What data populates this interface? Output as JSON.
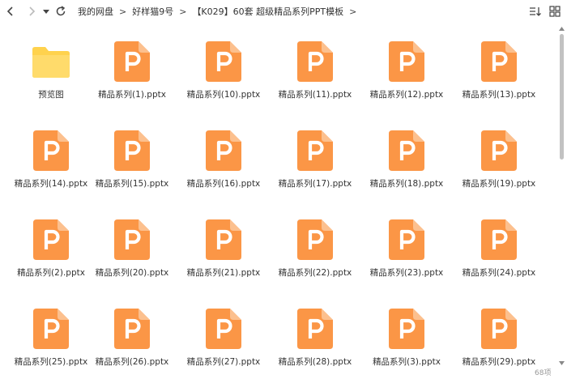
{
  "toolbar": {
    "breadcrumb": [
      "我的网盘",
      "好样猫9号",
      "【K029】60套 超级精品系列PPT模板"
    ],
    "separator": ">"
  },
  "colors": {
    "folder": "#ffd24d",
    "ppt_icon": "#fb9646",
    "ppt_icon_fold": "#fcc08e"
  },
  "items": [
    {
      "name": "预览图",
      "type": "folder"
    },
    {
      "name": "精品系列(1).pptx",
      "type": "pptx"
    },
    {
      "name": "精品系列(10).pptx",
      "type": "pptx"
    },
    {
      "name": "精品系列(11).pptx",
      "type": "pptx"
    },
    {
      "name": "精品系列(12).pptx",
      "type": "pptx"
    },
    {
      "name": "精品系列(13).pptx",
      "type": "pptx"
    },
    {
      "name": "精品系列(14).pptx",
      "type": "pptx"
    },
    {
      "name": "精品系列(15).pptx",
      "type": "pptx"
    },
    {
      "name": "精品系列(16).pptx",
      "type": "pptx"
    },
    {
      "name": "精品系列(17).pptx",
      "type": "pptx"
    },
    {
      "name": "精品系列(18).pptx",
      "type": "pptx"
    },
    {
      "name": "精品系列(19).pptx",
      "type": "pptx"
    },
    {
      "name": "精品系列(2).pptx",
      "type": "pptx"
    },
    {
      "name": "精品系列(20).pptx",
      "type": "pptx"
    },
    {
      "name": "精品系列(21).pptx",
      "type": "pptx"
    },
    {
      "name": "精品系列(22).pptx",
      "type": "pptx"
    },
    {
      "name": "精品系列(23).pptx",
      "type": "pptx"
    },
    {
      "name": "精品系列(24).pptx",
      "type": "pptx"
    },
    {
      "name": "精品系列(25).pptx",
      "type": "pptx"
    },
    {
      "name": "精品系列(26).pptx",
      "type": "pptx"
    },
    {
      "name": "精品系列(27).pptx",
      "type": "pptx"
    },
    {
      "name": "精品系列(28).pptx",
      "type": "pptx"
    },
    {
      "name": "精品系列(3).pptx",
      "type": "pptx"
    },
    {
      "name": "精品系列(29).pptx",
      "type": "pptx"
    }
  ],
  "item_count": "68项"
}
